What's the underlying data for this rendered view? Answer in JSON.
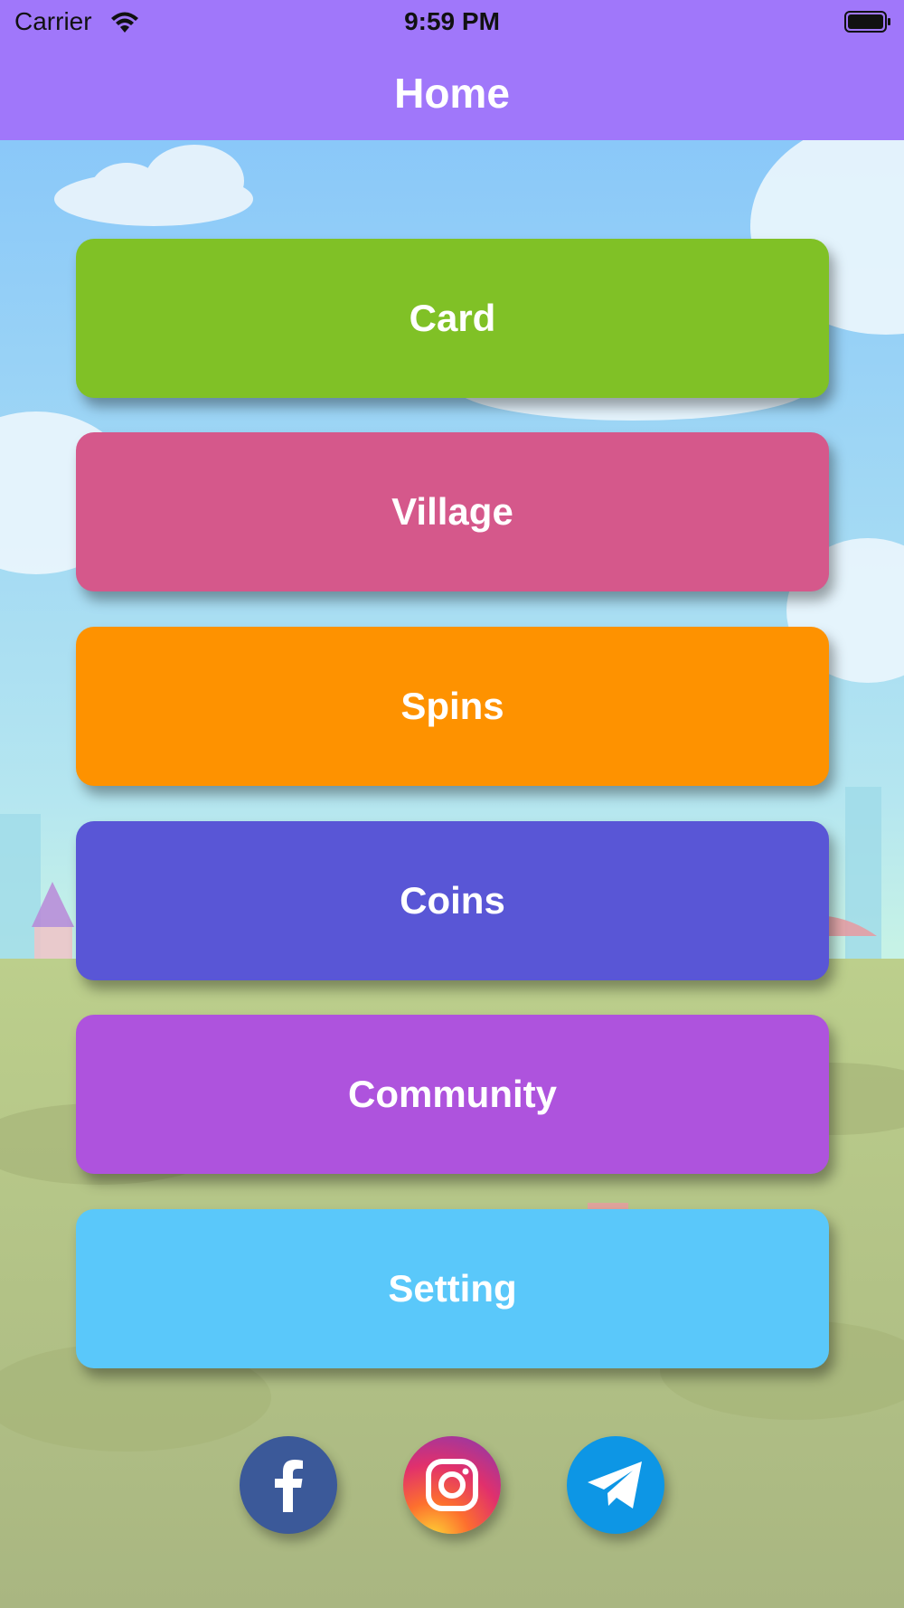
{
  "status_bar": {
    "carrier": "Carrier",
    "time": "9:59 PM"
  },
  "nav": {
    "title": "Home"
  },
  "menu": [
    {
      "label": "Card",
      "color": "#80c126"
    },
    {
      "label": "Village",
      "color": "#d5588b"
    },
    {
      "label": "Spins",
      "color": "#fe9200"
    },
    {
      "label": "Coins",
      "color": "#5956d6"
    },
    {
      "label": "Community",
      "color": "#ae53dd"
    },
    {
      "label": "Setting",
      "color": "#5ac8fa"
    }
  ],
  "social": [
    {
      "icon": "facebook-icon",
      "color": "#3b5999"
    },
    {
      "icon": "instagram-icon",
      "color": "#e1306c"
    },
    {
      "icon": "telegram-icon",
      "color": "#0d96e5"
    }
  ],
  "colors": {
    "header": "#a077fa",
    "sky_top": "#89c8fa",
    "grass": "#b7c98c"
  }
}
